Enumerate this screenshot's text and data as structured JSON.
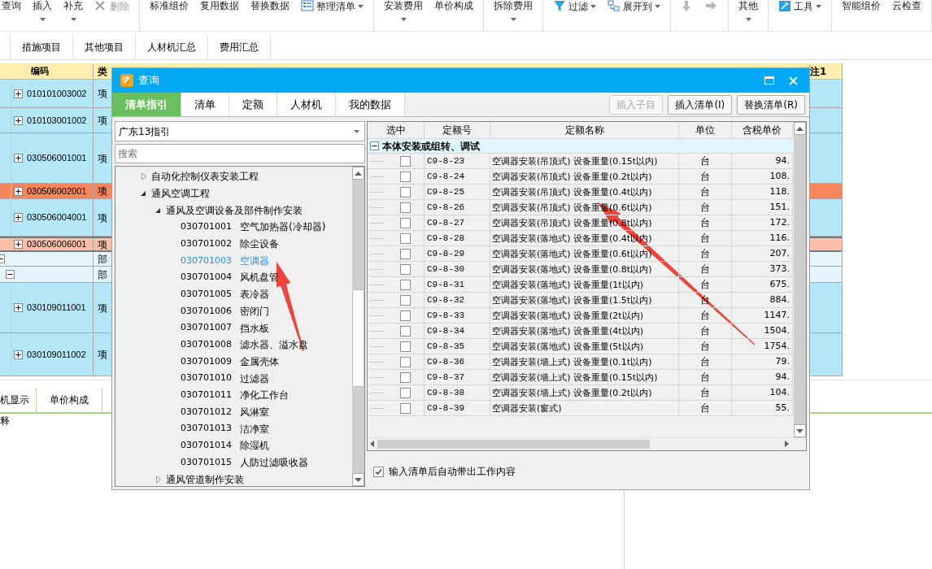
{
  "toolbar": {
    "groups": [
      {
        "items": [
          {
            "label": "查询",
            "kind": "plain",
            "dropdown": false,
            "disabled": false
          },
          {
            "label": "插入",
            "kind": "plain",
            "dropdown": true,
            "disabled": false
          },
          {
            "label": "补充",
            "kind": "plain",
            "dropdown": true,
            "disabled": false
          },
          {
            "label": "删除",
            "kind": "cross",
            "dropdown": false,
            "disabled": true
          }
        ]
      },
      {
        "items": [
          {
            "label": "标准组价",
            "kind": "plain",
            "dropdown": false,
            "disabled": false
          },
          {
            "label": "复用数据",
            "kind": "plain",
            "dropdown": false,
            "disabled": false
          },
          {
            "label": "替换数据",
            "kind": "plain",
            "dropdown": false,
            "disabled": false
          },
          {
            "label": "整理清单",
            "kind": "list",
            "dropdown": true,
            "disabled": false
          }
        ]
      },
      {
        "items": [
          {
            "label": "安装费用",
            "kind": "plain",
            "dropdown": true,
            "disabled": false
          },
          {
            "label": "单价构成",
            "kind": "plain",
            "dropdown": false,
            "disabled": false
          }
        ]
      },
      {
        "items": [
          {
            "label": "拆除费用",
            "kind": "plain",
            "dropdown": true,
            "disabled": false
          }
        ]
      },
      {
        "items": [
          {
            "label": "过滤",
            "kind": "funnel",
            "dropdown": true,
            "disabled": false
          },
          {
            "label": "展开到",
            "kind": "tree",
            "dropdown": true,
            "disabled": false
          }
        ]
      },
      {
        "items": [
          {
            "kind": "arrow-down",
            "dropdown": false,
            "disabled": true
          },
          {
            "kind": "arrow-right",
            "dropdown": false,
            "disabled": true
          }
        ]
      },
      {
        "items": [
          {
            "label": "其他",
            "kind": "plain",
            "dropdown": true,
            "disabled": false
          }
        ]
      },
      {
        "items": [
          {
            "label": "工具",
            "kind": "tools",
            "dropdown": true,
            "disabled": false
          }
        ]
      },
      {
        "items": [
          {
            "label": "智能组价",
            "kind": "plain",
            "dropdown": false,
            "disabled": false
          },
          {
            "label": "云检查",
            "kind": "plain",
            "dropdown": false,
            "disabled": false
          }
        ]
      }
    ]
  },
  "tabs": [
    {
      "label": "措施项目"
    },
    {
      "label": "其他项目"
    },
    {
      "label": "人材机汇总"
    },
    {
      "label": "费用汇总"
    }
  ],
  "grid": {
    "columns": [
      "编码",
      "类",
      "注1"
    ],
    "rows": [
      {
        "kind": "item",
        "code": "010101003002",
        "type": "项",
        "expanded": false,
        "selected": false,
        "marked": false
      },
      {
        "kind": "item",
        "code": "010103001002",
        "type": "项",
        "expanded": false,
        "selected": false,
        "marked": false
      },
      {
        "kind": "item",
        "code": "030506001001",
        "type": "项",
        "expanded": false,
        "selected": false,
        "marked": false
      },
      {
        "kind": "item",
        "code": "030506002001",
        "type": "项",
        "expanded": false,
        "selected": true,
        "marked": false
      },
      {
        "kind": "item",
        "code": "030506004001",
        "type": "项",
        "expanded": false,
        "selected": false,
        "marked": false
      },
      {
        "kind": "item",
        "code": "030506006001",
        "type": "项",
        "expanded": false,
        "selected": false,
        "marked": true
      },
      {
        "kind": "section",
        "type": "部",
        "expanded": true,
        "selected": false,
        "marked": false,
        "children": [
          {
            "kind": "section",
            "type": "部",
            "expanded": true,
            "selected": false,
            "marked": false,
            "children": [
              {
                "kind": "item",
                "code": "030109011001",
                "type": "项",
                "expanded": false,
                "selected": false,
                "marked": false
              },
              {
                "kind": "item",
                "code": "030109011002",
                "type": "项",
                "expanded": false,
                "selected": false,
                "marked": false
              }
            ]
          }
        ]
      }
    ]
  },
  "bottom": {
    "tabs": [
      {
        "label": "机显示"
      },
      {
        "label": "单价构成"
      }
    ],
    "note": "释"
  },
  "dialog": {
    "title": "查询",
    "tabs": [
      {
        "label": "清单指引",
        "selected": true
      },
      {
        "label": "清单",
        "selected": false
      },
      {
        "label": "定额",
        "selected": false
      },
      {
        "label": "人材机",
        "selected": false
      },
      {
        "label": "我的数据",
        "selected": false
      }
    ],
    "buttons": [
      {
        "label": "插入子目",
        "disabled": true
      },
      {
        "label": "插入清单(I)",
        "disabled": false
      },
      {
        "label": "替换清单(R)",
        "disabled": false
      }
    ],
    "guide": {
      "value": "广东13指引"
    },
    "search": {
      "placeholder": "搜索"
    },
    "tree": [
      {
        "kind": "group",
        "label": "自动化控制仪表安装工程",
        "expanded": false
      },
      {
        "kind": "group",
        "label": "通风空调工程",
        "expanded": true,
        "children": [
          {
            "kind": "group",
            "label": "通风及空调设备及部件制作安装",
            "expanded": true,
            "children": [
              {
                "kind": "leaf",
                "code": "030701001",
                "label": "空气加热器(冷却器)",
                "selected": false
              },
              {
                "kind": "leaf",
                "code": "030701002",
                "label": "除尘设备",
                "selected": false
              },
              {
                "kind": "leaf",
                "code": "030701003",
                "label": "空调器",
                "selected": true
              },
              {
                "kind": "leaf",
                "code": "030701004",
                "label": "风机盘管",
                "selected": false
              },
              {
                "kind": "leaf",
                "code": "030701005",
                "label": "表冷器",
                "selected": false
              },
              {
                "kind": "leaf",
                "code": "030701006",
                "label": "密闭门",
                "selected": false
              },
              {
                "kind": "leaf",
                "code": "030701007",
                "label": "挡水板",
                "selected": false
              },
              {
                "kind": "leaf",
                "code": "030701008",
                "label": "滤水器、溢水盘",
                "selected": false
              },
              {
                "kind": "leaf",
                "code": "030701009",
                "label": "金属壳体",
                "selected": false
              },
              {
                "kind": "leaf",
                "code": "030701010",
                "label": "过滤器",
                "selected": false
              },
              {
                "kind": "leaf",
                "code": "030701011",
                "label": "净化工作台",
                "selected": false
              },
              {
                "kind": "leaf",
                "code": "030701012",
                "label": "风淋室",
                "selected": false
              },
              {
                "kind": "leaf",
                "code": "030701013",
                "label": "洁净室",
                "selected": false
              },
              {
                "kind": "leaf",
                "code": "030701014",
                "label": "除湿机",
                "selected": false
              },
              {
                "kind": "leaf",
                "code": "030701015",
                "label": "人防过滤吸收器",
                "selected": false
              }
            ]
          },
          {
            "kind": "group",
            "label": "通风管道制作安装",
            "expanded": false
          }
        ]
      }
    ],
    "table": {
      "columns": [
        "选中",
        "定额号",
        "定额名称",
        "单位",
        "含税单价"
      ],
      "groups": [
        {
          "label": "本体安装或组转、调试",
          "expanded": true,
          "rows": [
            {
              "code": "C9-8-23",
              "name": "空调器安装(吊顶式) 设备重量(0.15t以内)",
              "unit": "台",
              "price": "94.",
              "checked": false
            },
            {
              "code": "C9-8-24",
              "name": "空调器安装(吊顶式) 设备重量(0.2t以内)",
              "unit": "台",
              "price": "108.",
              "checked": false
            },
            {
              "code": "C9-8-25",
              "name": "空调器安装(吊顶式) 设备重量(0.4t以内)",
              "unit": "台",
              "price": "118.",
              "checked": false
            },
            {
              "code": "C9-8-26",
              "name": "空调器安装(吊顶式) 设备重量(0.6t以内)",
              "unit": "台",
              "price": "151.",
              "checked": false
            },
            {
              "code": "C9-8-27",
              "name": "空调器安装(吊顶式) 设备重量(0.8t以内)",
              "unit": "台",
              "price": "172.",
              "checked": false
            },
            {
              "code": "C9-8-28",
              "name": "空调器安装(落地式) 设备重量(0.4t以内)",
              "unit": "台",
              "price": "116.",
              "checked": false
            },
            {
              "code": "C9-8-29",
              "name": "空调器安装(落地式) 设备重量(0.6t以内)",
              "unit": "台",
              "price": "207.",
              "checked": false
            },
            {
              "code": "C9-8-30",
              "name": "空调器安装(落地式) 设备重量(0.8t以内)",
              "unit": "台",
              "price": "373.",
              "checked": false
            },
            {
              "code": "C9-8-31",
              "name": "空调器安装(落地式) 设备重量(1t以内)",
              "unit": "台",
              "price": "675.",
              "checked": false
            },
            {
              "code": "C9-8-32",
              "name": "空调器安装(落地式) 设备重量(1.5t以内)",
              "unit": "台",
              "price": "884.",
              "checked": false
            },
            {
              "code": "C9-8-33",
              "name": "空调器安装(落地式) 设备重量(2t以内)",
              "unit": "台",
              "price": "1147.",
              "checked": false
            },
            {
              "code": "C9-8-34",
              "name": "空调器安装(落地式) 设备重量(4t以内)",
              "unit": "台",
              "price": "1504.",
              "checked": false
            },
            {
              "code": "C9-8-35",
              "name": "空调器安装(落地式) 设备重量(5t以内)",
              "unit": "台",
              "price": "1754.",
              "checked": false
            },
            {
              "code": "C9-8-36",
              "name": "空调器安装(墙上式) 设备重量(0.1t以内)",
              "unit": "台",
              "price": "79.",
              "checked": false
            },
            {
              "code": "C9-8-37",
              "name": "空调器安装(墙上式) 设备重量(0.15t以内)",
              "unit": "台",
              "price": "94.",
              "checked": false
            },
            {
              "code": "C9-8-38",
              "name": "空调器安装(墙上式) 设备重量(0.2t以内)",
              "unit": "台",
              "price": "104.",
              "checked": false
            },
            {
              "code": "C9-8-39",
              "name": "空调器安装(窗式)",
              "unit": "台",
              "price": "55.",
              "checked": false
            }
          ]
        }
      ]
    },
    "option": {
      "label": "输入清单后自动带出工作内容",
      "checked": true
    }
  }
}
